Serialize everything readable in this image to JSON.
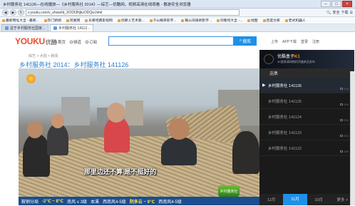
{
  "window": {
    "title": "乡村服务社 141126—在线播放—《乡村服务社 2014》—综艺—优酷网，视频高清在线观看 - 傲游安全浏览器"
  },
  "nav": {
    "url": "v.youku.com/v_show/id_XODI3NjkzODQw.html",
    "right_items": [
      "🔍",
      "安全",
      "下载",
      "☰"
    ]
  },
  "favorites": [
    "最新网址大全 - 最新...",
    "热门新闻",
    "凤凰网",
    "乐看经典影视网",
    "优鲸人艺术家...",
    "千山概率影字...",
    "鞍山日报新影字...",
    "何看何大全 -...",
    "地图",
    "百度文库",
    "老式机器人"
  ],
  "tabs": [
    {
      "label": "这于乡村服务社国家..."
    },
    {
      "label": "乡村服务社 14112..."
    }
  ],
  "youku": {
    "logo_main": "YOUKU",
    "logo_sub": "优酷",
    "nav_items": [
      "首页",
      "频道",
      "订阅"
    ],
    "search_button": "搜库",
    "top_right": [
      "上传",
      "APP下载",
      "登录",
      "注册"
    ],
    "breadcrumb": "综艺 > 大陆 > 新闻",
    "video_title": "乡村服务社 2014：乡村服务社 141126"
  },
  "player": {
    "subtitle": "那里边还不算 是不挺好的",
    "ticker": [
      "鞍钢分局",
      "-2℃ ~ 8℃",
      "南风 ≤ 3级",
      "本溪",
      "西南风4-5级",
      "阴多云 ~ 9℃",
      "西南风4-5级"
    ],
    "corner_logo": "乡村服务社"
  },
  "ad": {
    "brand": "优酷盒子",
    "model": "K1",
    "tagline": "4K超高清网络机顶盒新品发布"
  },
  "playlist": {
    "header": "选集",
    "items": [
      {
        "title": "乡村服务社 141126",
        "count": "215",
        "active": true
      },
      {
        "title": "乡村服务社 141125",
        "count": "200",
        "active": false
      },
      {
        "title": "乡村服务社 141124",
        "count": "200",
        "active": false
      },
      {
        "title": "乡村服务社 141123",
        "count": "200",
        "active": false
      },
      {
        "title": "乡村服务社 141122",
        "count": "155",
        "active": false
      }
    ],
    "months": [
      "12月",
      "11月",
      "10月",
      "更多 >"
    ]
  }
}
